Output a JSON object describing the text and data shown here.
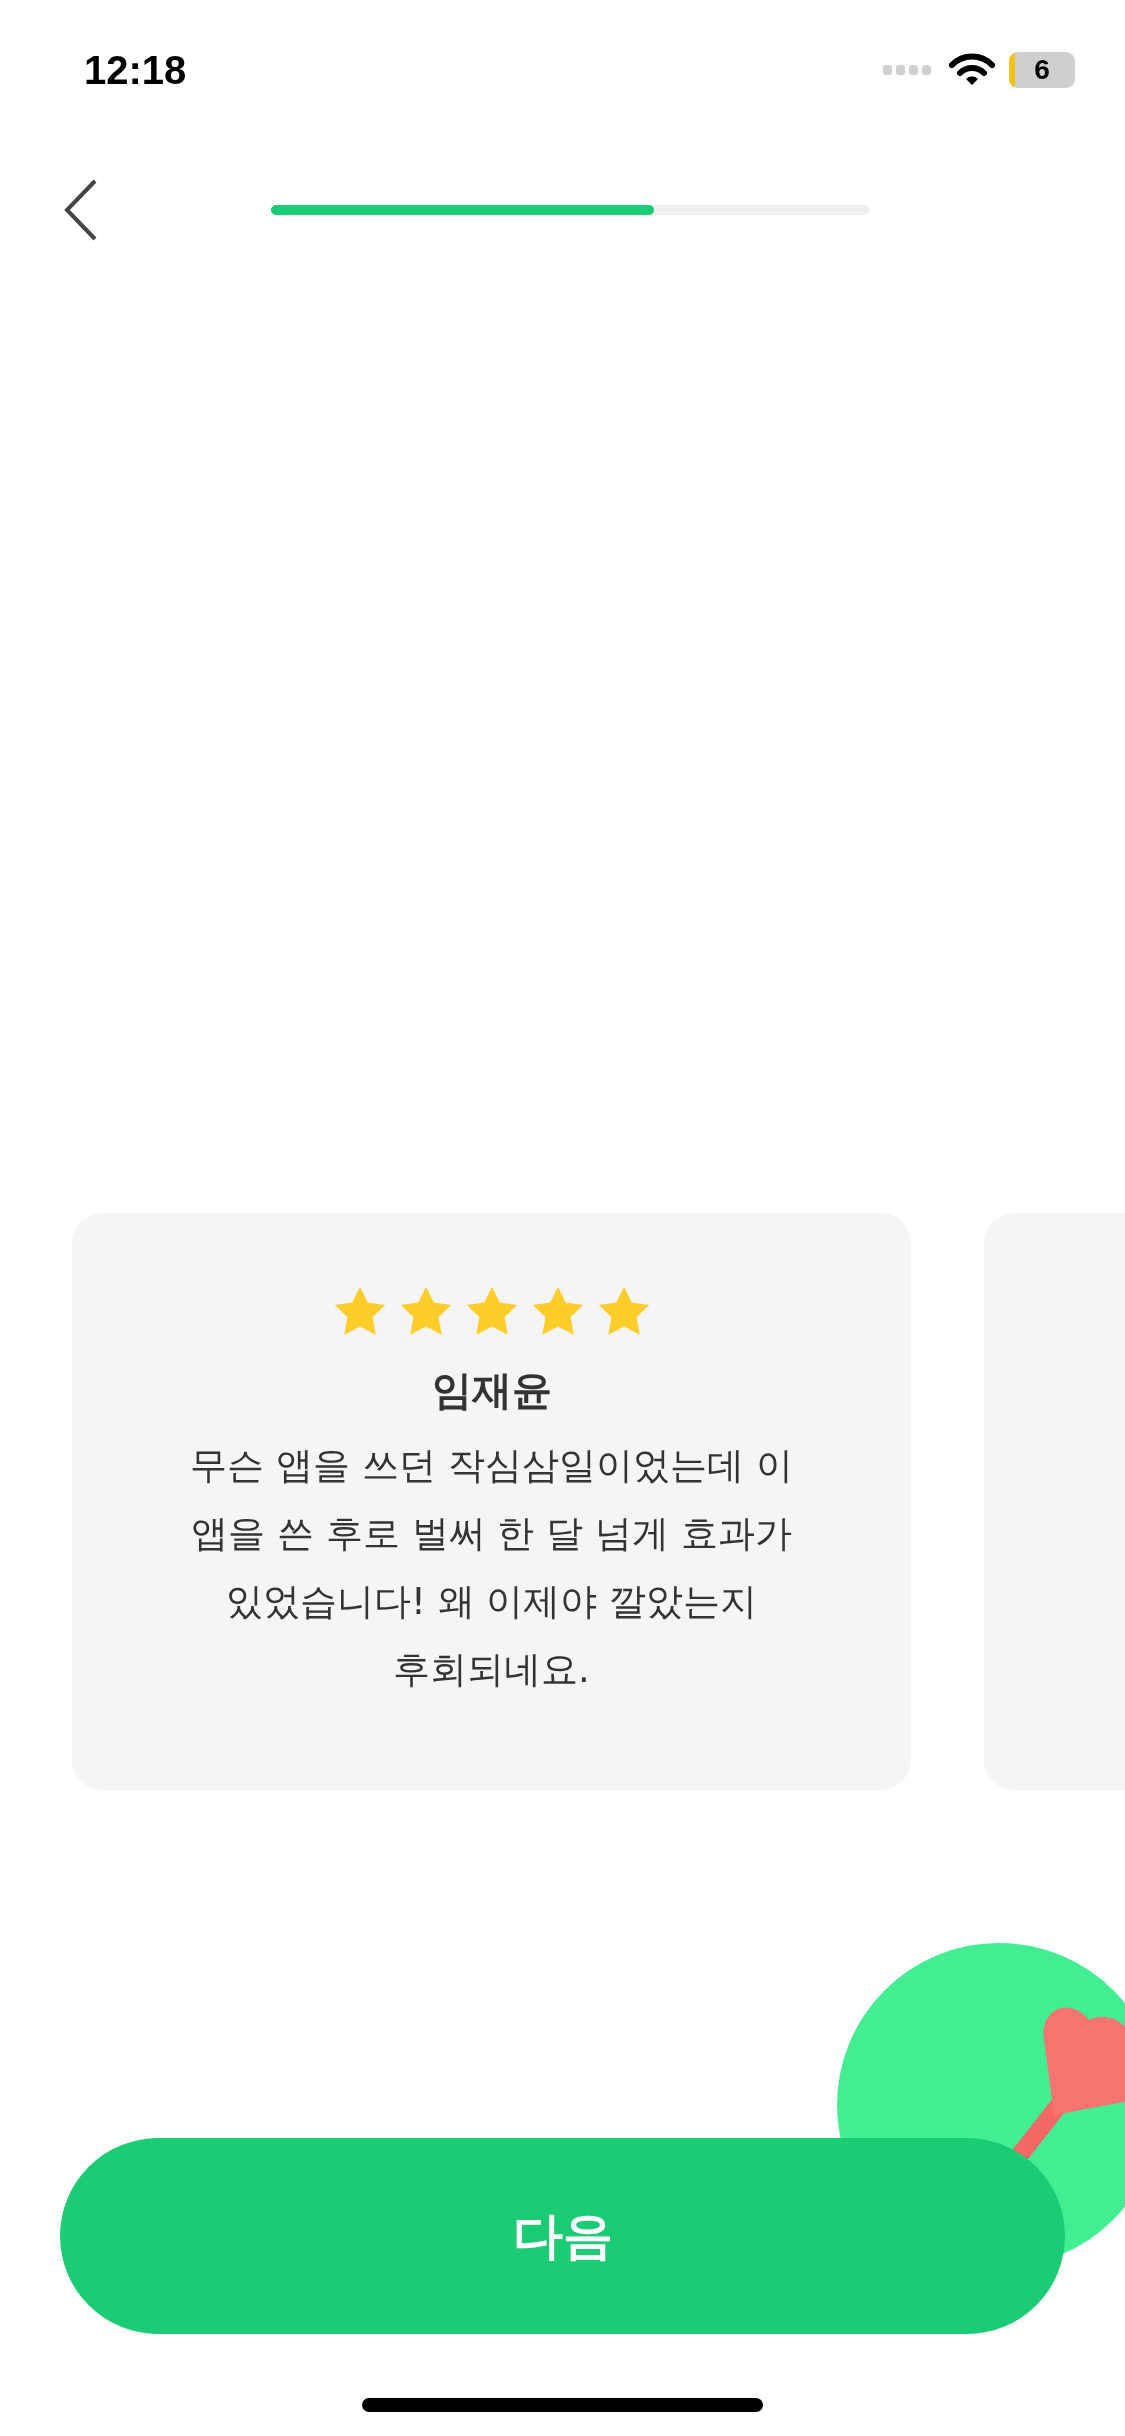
{
  "status_bar": {
    "time": "12:18",
    "battery": "6"
  },
  "progress": {
    "level": 0.64
  },
  "reviews": [
    {
      "stars": 5,
      "name": "임재윤",
      "text": "무슨 앱을 쓰던 작심삼일이었는데 이\n앱을 쓴 후로 벌써 한 달 넘게 효과가\n있었습니다! 왜 이제야 깔았는지\n후회되네요."
    }
  ],
  "next_card_visible": true,
  "next_button": "다음"
}
